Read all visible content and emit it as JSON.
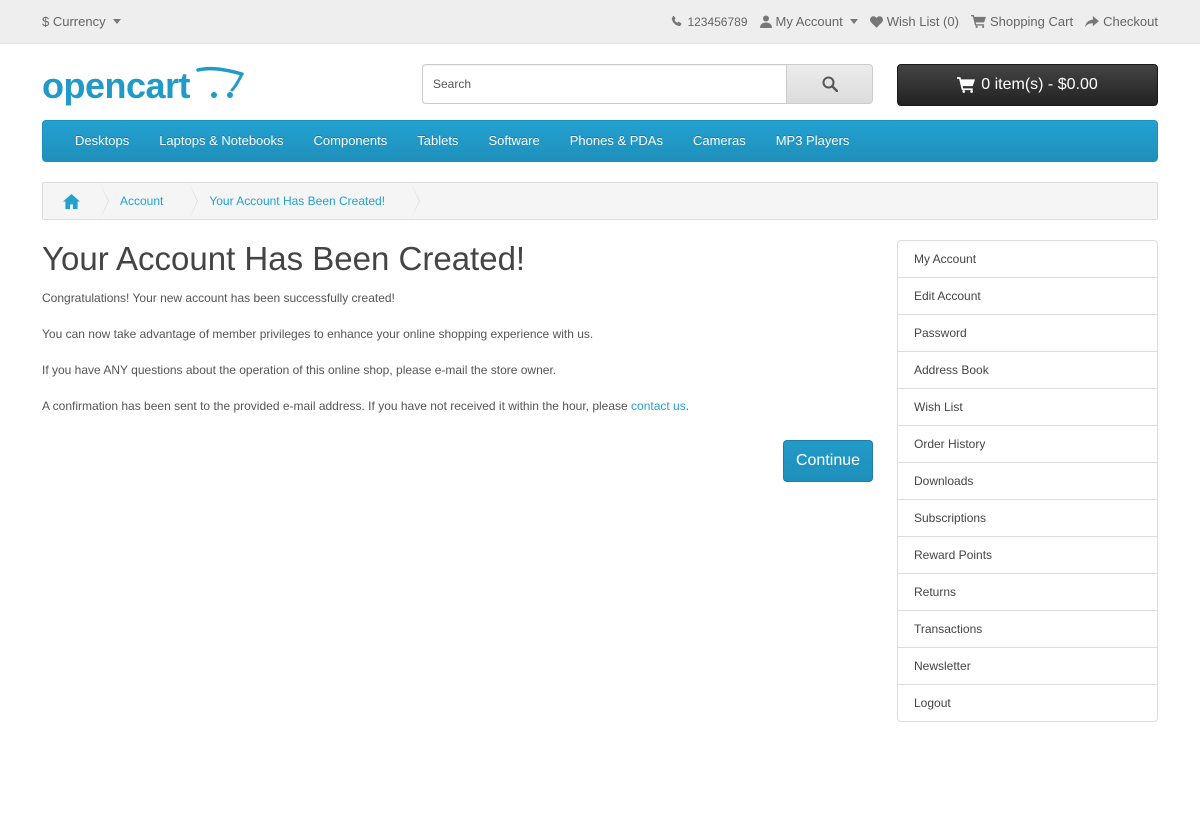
{
  "topbar": {
    "currency_label": "$ Currency",
    "phone": "123456789",
    "my_account": "My Account",
    "wish_list": "Wish List (0)",
    "shopping_cart": "Shopping Cart",
    "checkout": "Checkout"
  },
  "header": {
    "logo_text": "opencart",
    "search_placeholder": "Search",
    "cart_label": "0 item(s) - $0.00"
  },
  "menu": {
    "items": [
      "Desktops",
      "Laptops & Notebooks",
      "Components",
      "Tablets",
      "Software",
      "Phones & PDAs",
      "Cameras",
      "MP3 Players"
    ]
  },
  "breadcrumb": {
    "items": [
      "Account",
      "Your Account Has Been Created!"
    ]
  },
  "main": {
    "title": "Your Account Has Been Created!",
    "paragraphs": [
      "Congratulations! Your new account has been successfully created!",
      "You can now take advantage of member privileges to enhance your online shopping experience with us.",
      "If you have ANY questions about the operation of this online shop, please e-mail the store owner.",
      "A confirmation has been sent to the provided e-mail address. If you have not received it within the hour, please "
    ],
    "contact_link": "contact us",
    "after_link": ".",
    "continue_label": "Continue"
  },
  "sidebar": {
    "items": [
      "My Account",
      "Edit Account",
      "Password",
      "Address Book",
      "Wish List",
      "Order History",
      "Downloads",
      "Subscriptions",
      "Reward Points",
      "Returns",
      "Transactions",
      "Newsletter",
      "Logout"
    ]
  },
  "colors": {
    "accent": "#229ac8",
    "topbar_bg": "#eeeeee",
    "cart_bg": "#303030"
  }
}
